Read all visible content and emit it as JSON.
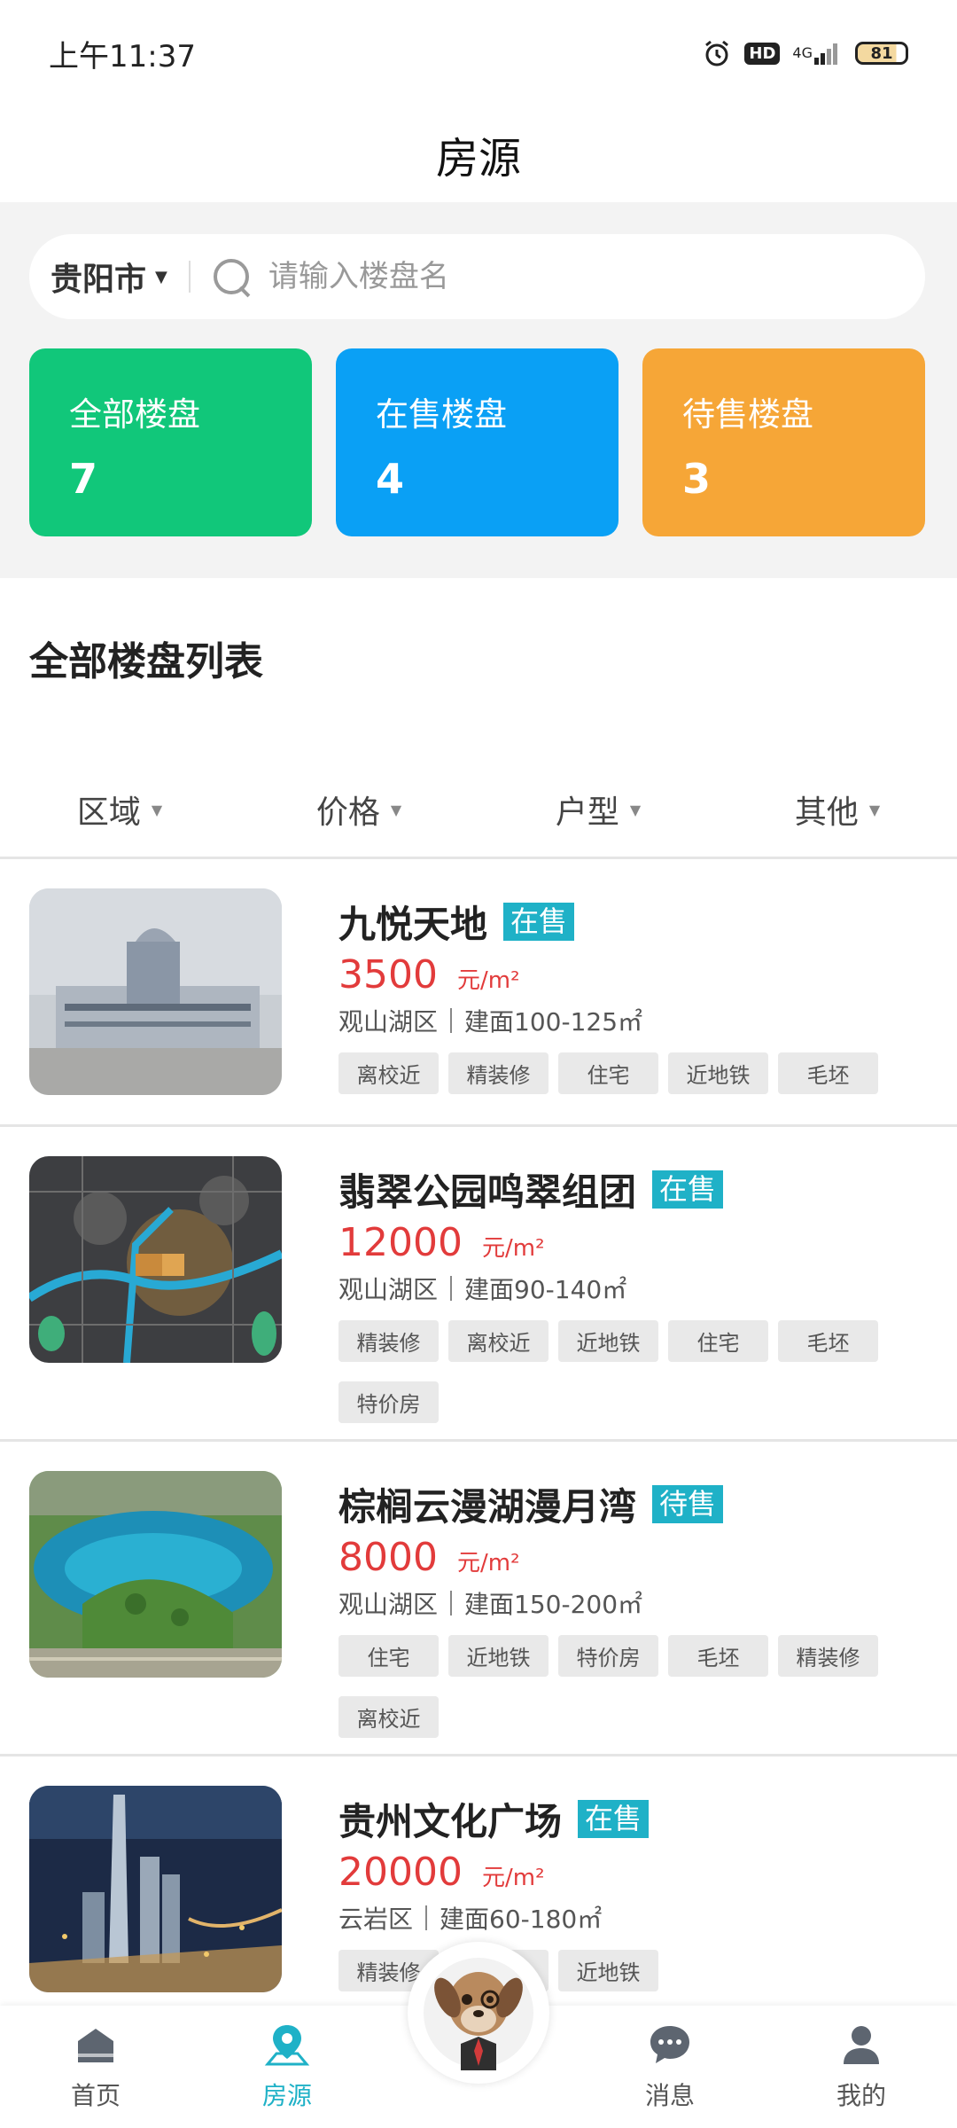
{
  "status_bar": {
    "time": "上午11:37",
    "hd": "HD",
    "network": "4G",
    "battery": "81"
  },
  "header": {
    "title": "房源"
  },
  "search": {
    "city": "贵阳市",
    "placeholder": "请输入楼盘名"
  },
  "stats": [
    {
      "label": "全部楼盘",
      "count": "7",
      "color": "#11c77a"
    },
    {
      "label": "在售楼盘",
      "count": "4",
      "color": "#0aa0f5"
    },
    {
      "label": "待售楼盘",
      "count": "3",
      "color": "#f6a637"
    }
  ],
  "section_title": "全部楼盘列表",
  "filters": [
    "区域",
    "价格",
    "户型",
    "其他"
  ],
  "listings": [
    {
      "name": "九悦天地",
      "status": "在售",
      "price": "3500",
      "unit": "元/m²",
      "district": "观山湖区",
      "area": "建面100-125㎡",
      "tags": [
        "离校近",
        "精装修",
        "住宅",
        "近地铁",
        "毛坯"
      ]
    },
    {
      "name": "翡翠公园鸣翠组团",
      "status": "在售",
      "price": "12000",
      "unit": "元/m²",
      "district": "观山湖区",
      "area": "建面90-140㎡",
      "tags": [
        "精装修",
        "离校近",
        "近地铁",
        "住宅",
        "毛坯",
        "特价房"
      ]
    },
    {
      "name": "棕榈云漫湖漫月湾",
      "status": "待售",
      "price": "8000",
      "unit": "元/m²",
      "district": "观山湖区",
      "area": "建面150-200㎡",
      "tags": [
        "住宅",
        "近地铁",
        "特价房",
        "毛坯",
        "精装修",
        "离校近"
      ]
    },
    {
      "name": "贵州文化广场",
      "status": "在售",
      "price": "20000",
      "unit": "元/m²",
      "district": "云岩区",
      "area": "建面60-180㎡",
      "tags": [
        "精装修",
        "离校近",
        "近地铁"
      ]
    }
  ],
  "bottom_nav": {
    "items": [
      {
        "label": "首页",
        "icon": "home-icon"
      },
      {
        "label": "房源",
        "icon": "location-pin-icon"
      },
      {
        "label": "消息",
        "icon": "chat-bubble-icon"
      },
      {
        "label": "我的",
        "icon": "user-icon"
      }
    ],
    "active": "房源",
    "active_color": "#1fb1c7"
  }
}
